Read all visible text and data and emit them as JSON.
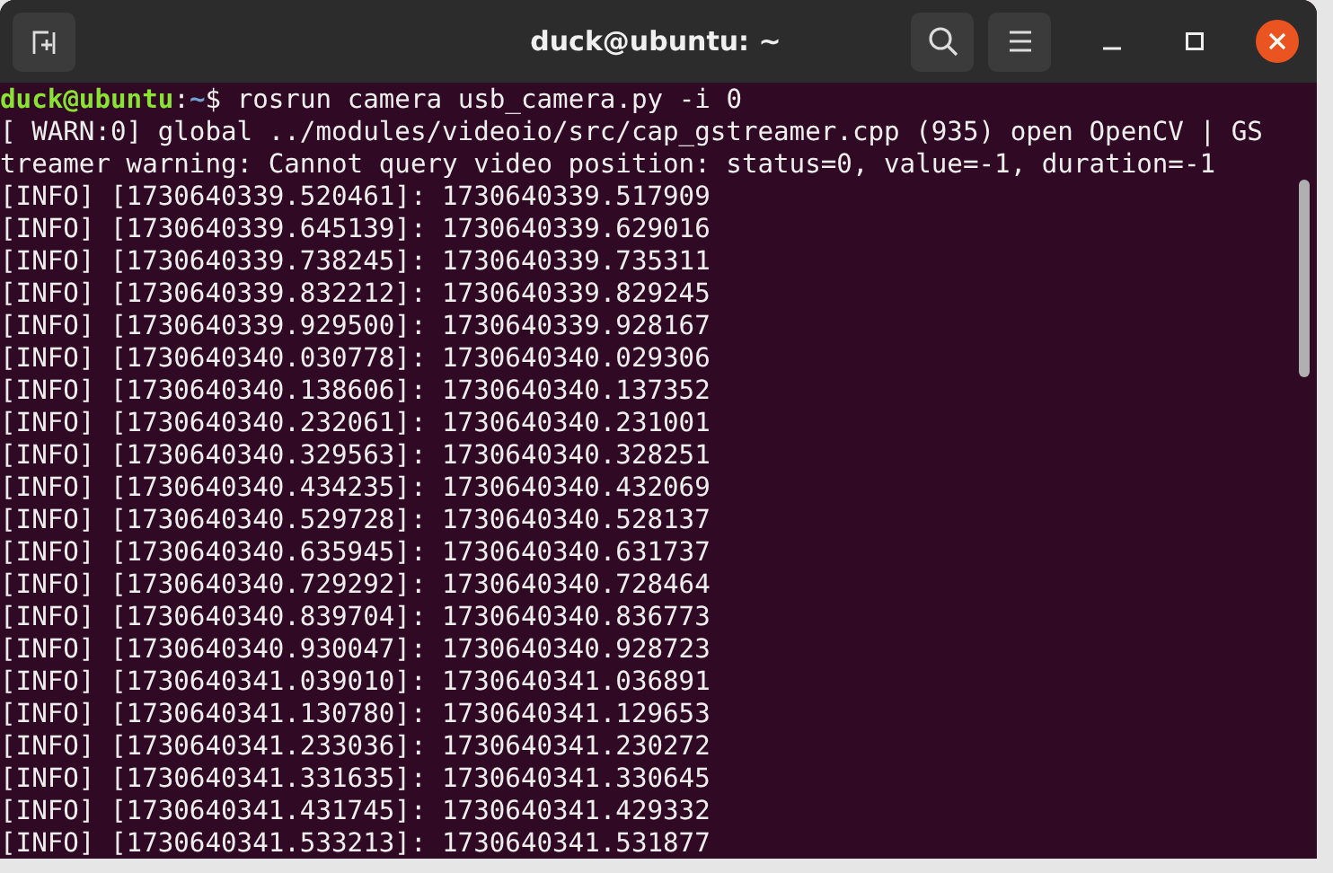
{
  "window": {
    "title": "duck@ubuntu: ~"
  },
  "prompt": {
    "user_host": "duck@ubuntu",
    "separator": ":",
    "path": "~",
    "symbol": "$",
    "command": "rosrun camera usb_camera.py -i 0"
  },
  "output_lines": [
    "[ WARN:0] global ../modules/videoio/src/cap_gstreamer.cpp (935) open OpenCV | GS",
    "treamer warning: Cannot query video position: status=0, value=-1, duration=-1",
    "[INFO] [1730640339.520461]: 1730640339.517909",
    "[INFO] [1730640339.645139]: 1730640339.629016",
    "[INFO] [1730640339.738245]: 1730640339.735311",
    "[INFO] [1730640339.832212]: 1730640339.829245",
    "[INFO] [1730640339.929500]: 1730640339.928167",
    "[INFO] [1730640340.030778]: 1730640340.029306",
    "[INFO] [1730640340.138606]: 1730640340.137352",
    "[INFO] [1730640340.232061]: 1730640340.231001",
    "[INFO] [1730640340.329563]: 1730640340.328251",
    "[INFO] [1730640340.434235]: 1730640340.432069",
    "[INFO] [1730640340.529728]: 1730640340.528137",
    "[INFO] [1730640340.635945]: 1730640340.631737",
    "[INFO] [1730640340.729292]: 1730640340.728464",
    "[INFO] [1730640340.839704]: 1730640340.836773",
    "[INFO] [1730640340.930047]: 1730640340.928723",
    "[INFO] [1730640341.039010]: 1730640341.036891",
    "[INFO] [1730640341.130780]: 1730640341.129653",
    "[INFO] [1730640341.233036]: 1730640341.230272",
    "[INFO] [1730640341.331635]: 1730640341.330645",
    "[INFO] [1730640341.431745]: 1730640341.429332",
    "[INFO] [1730640341.533213]: 1730640341.531877"
  ]
}
